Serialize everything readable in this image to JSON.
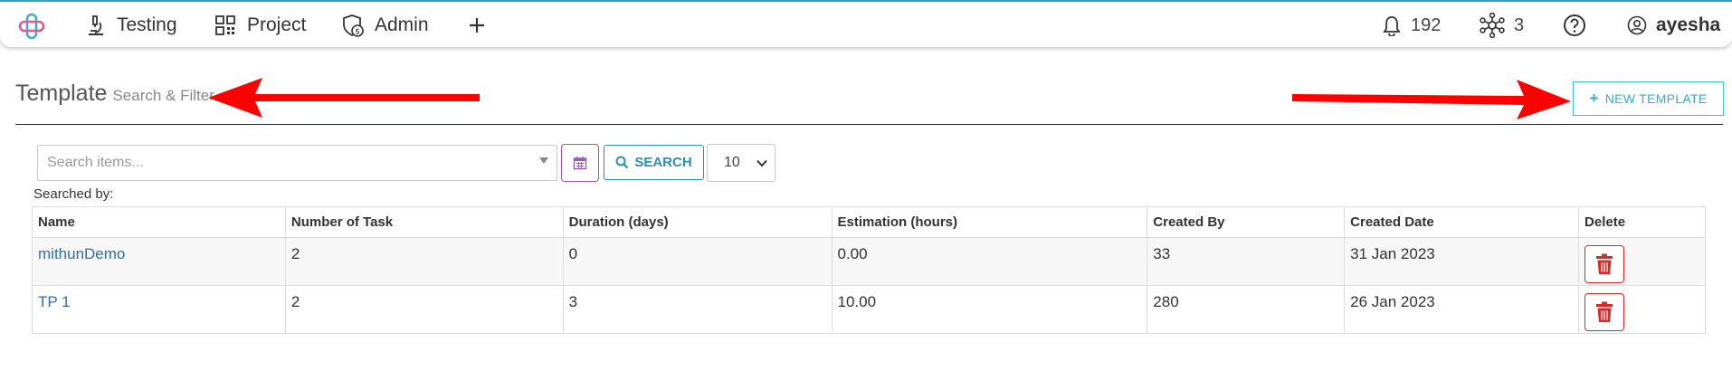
{
  "nav": {
    "items": [
      {
        "label": "Testing",
        "icon": "microscope-icon"
      },
      {
        "label": "Project",
        "icon": "qr-grid-icon"
      },
      {
        "label": "Admin",
        "icon": "shield-dollar-icon"
      }
    ],
    "add_icon": "plus-icon",
    "notifications_count": "192",
    "network_count": "3",
    "help_icon": "help-icon",
    "user_name": "ayesha"
  },
  "page": {
    "title": "Template",
    "subtitle": "Search & Filter",
    "new_button_label": "NEW TEMPLATE"
  },
  "search": {
    "placeholder": "Search items...",
    "button_label": "SEARCH",
    "page_size": "10",
    "searched_by_label": "Searched by:"
  },
  "table": {
    "headers": [
      "Name",
      "Number of Task",
      "Duration (days)",
      "Estimation (hours)",
      "Created By",
      "Created Date",
      "Delete"
    ],
    "rows": [
      {
        "name": "mithunDemo",
        "tasks": "2",
        "duration": "0",
        "estimation": "0.00",
        "created_by": "33",
        "created_date": "31 Jan 2023"
      },
      {
        "name": "TP 1",
        "tasks": "2",
        "duration": "3",
        "estimation": "10.00",
        "created_by": "280",
        "created_date": "26 Jan 2023"
      }
    ]
  },
  "colors": {
    "accent": "#2aa6b8",
    "link": "#2d6fa8",
    "danger": "#d42a2a",
    "annotation_red": "#ff0000"
  }
}
